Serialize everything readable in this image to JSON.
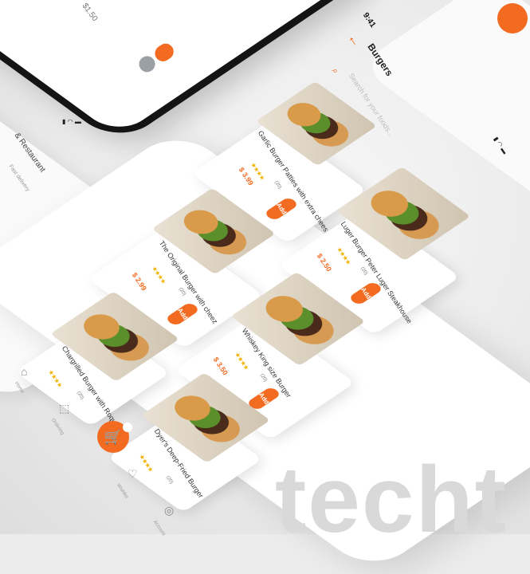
{
  "screen": {
    "time": "9:41",
    "title": "Burgers"
  },
  "search": {
    "placeholder": "Search for your foods..."
  },
  "bg_phones": {
    "price": "$1.50",
    "restaurant": "& Restaurant",
    "restaurant_sub": "Fast delivery"
  },
  "products": [
    {
      "name": "Garlic Burger Patties with extra chees",
      "price": "$ 3.99",
      "stars": "★★★★",
      "reviews": "(20)",
      "add_label": "Add"
    },
    {
      "name": "Luger Burger Peter Luger Steakhouse",
      "price": "$ 2.50",
      "stars": "★★★★",
      "reviews": "(20)",
      "add_label": "Add"
    },
    {
      "name": "The Original Burger with cheez",
      "price": "$ 2.99",
      "stars": "★★★★",
      "reviews": "(20)",
      "add_label": "Add"
    },
    {
      "name": "Whiskey King size Burger",
      "price": "$ 3.50",
      "stars": "★★★★",
      "reviews": "(20)",
      "add_label": "Add"
    },
    {
      "name": "Chargrilled Burger with Roquefort",
      "price": "",
      "stars": "★★★★",
      "reviews": "(20)",
      "add_label": ""
    },
    {
      "name": "Dyer's Deep-Fried Burger",
      "price": "",
      "stars": "★★★★",
      "reviews": "(20)",
      "add_label": ""
    }
  ],
  "nav": [
    {
      "label": "Home",
      "icon": "home-icon"
    },
    {
      "label": "Ordering",
      "icon": "box-icon"
    },
    {
      "label": "Wishlist",
      "icon": "heart-icon"
    },
    {
      "label": "Account",
      "icon": "user-icon"
    }
  ],
  "watermark": "techt",
  "colors": {
    "accent": "#f26b21",
    "star": "#f2b300"
  }
}
